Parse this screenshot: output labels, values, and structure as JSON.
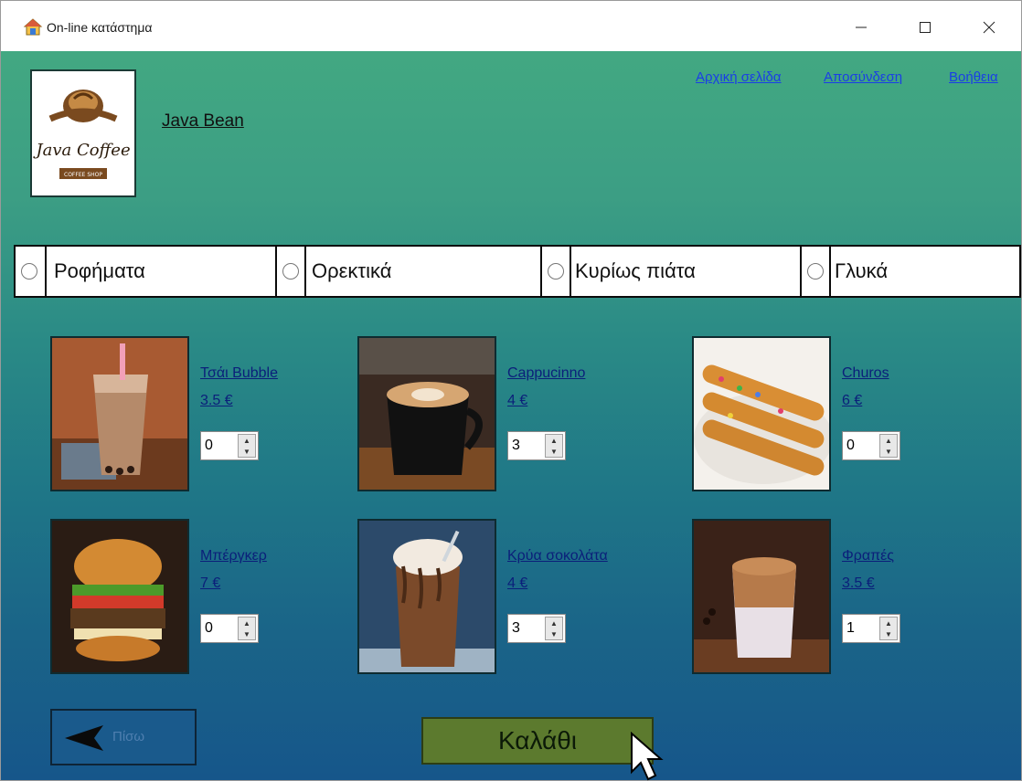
{
  "window": {
    "title": "On-line κατάστημα"
  },
  "header": {
    "store_name": "Java Bean",
    "logo": {
      "text_main": "Java Coffee",
      "text_sub": "COFFEE SHOP"
    },
    "links": [
      {
        "label": "Αρχική σελίδα"
      },
      {
        "label": "Αποσύνδεση"
      },
      {
        "label": "Βοήθεια"
      }
    ]
  },
  "categories": [
    {
      "label": "Ροφήματα",
      "selected": false
    },
    {
      "label": "Ορεκτικά",
      "selected": false
    },
    {
      "label": "Κυρίως πιάτα",
      "selected": false
    },
    {
      "label": "Γλυκά",
      "selected": false
    }
  ],
  "products": [
    {
      "name": "Τσάι Bubble",
      "price": "3.5 €",
      "quantity": "0"
    },
    {
      "name": "Cappucinno",
      "price": "4 €",
      "quantity": "3"
    },
    {
      "name": "Churos",
      "price": "6 €",
      "quantity": "0"
    },
    {
      "name": "Μπέργκερ",
      "price": "7 €",
      "quantity": "0"
    },
    {
      "name": "Κρύα σοκολάτα",
      "price": "4 €",
      "quantity": "3"
    },
    {
      "name": "Φραπές",
      "price": "3.5 €",
      "quantity": "1"
    }
  ],
  "footer": {
    "back_label": "Πίσω",
    "cart_label": "Καλάθι"
  },
  "colors": {
    "link": "#1a3ee6",
    "product_link": "#0b1f7a",
    "cart_button": "#5c7a2e"
  }
}
